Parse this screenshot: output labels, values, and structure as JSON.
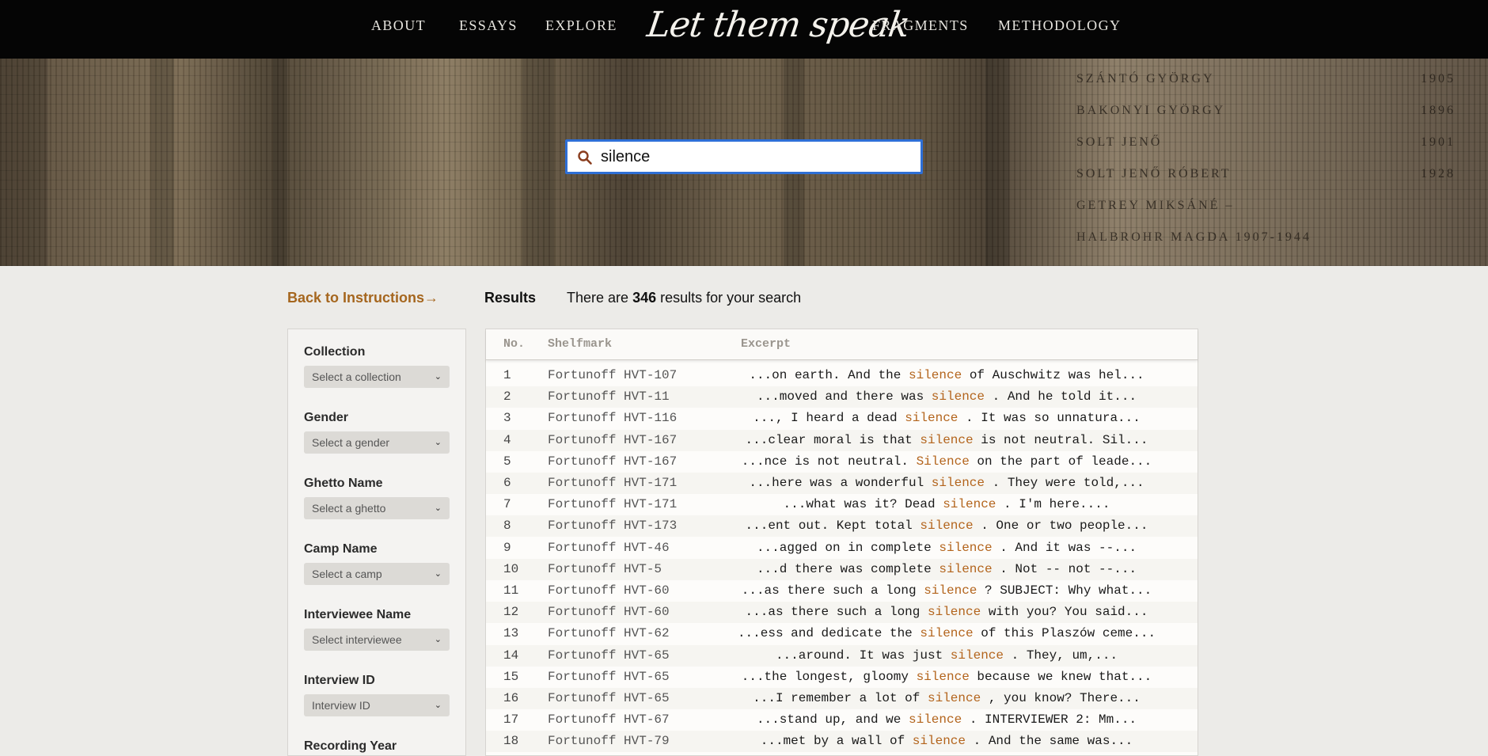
{
  "nav": {
    "left": [
      "ABOUT",
      "ESSAYS",
      "EXPLORE"
    ],
    "logo": "Let them speak",
    "right": [
      "FRAGMENTS",
      "METHODOLOGY"
    ]
  },
  "hero": {
    "memorial_names": [
      {
        "name": "SZÁNTÓ GYÖRGY",
        "year": "1905"
      },
      {
        "name": "BAKONYI GYÖRGY",
        "year": "1896"
      },
      {
        "name": "SOLT JENŐ",
        "year": "1901"
      },
      {
        "name": "SOLT JENŐ RÓBERT",
        "year": "1928"
      },
      {
        "name": "GETREY MIKSÁNÉ –",
        "year": ""
      },
      {
        "name": "HALBROHR MAGDA 1907-1944",
        "year": ""
      }
    ]
  },
  "search": {
    "value": "silence",
    "icon": "search-icon"
  },
  "back_link": "Back to Instructions→",
  "results": {
    "title": "Results",
    "count_prefix": "There are",
    "count": "346",
    "count_suffix": "results for your search",
    "columns": [
      "No.",
      "Shelfmark",
      "Excerpt"
    ],
    "rows": [
      {
        "no": "1",
        "shelfmark": "Fortunoff HVT-107",
        "before": "...on earth. And the",
        "hit": "silence",
        "after": "of Auschwitz was hel..."
      },
      {
        "no": "2",
        "shelfmark": "Fortunoff HVT-11",
        "before": "...moved and there was",
        "hit": "silence",
        "after": ". And he told it..."
      },
      {
        "no": "3",
        "shelfmark": "Fortunoff HVT-116",
        "before": "..., I heard a dead",
        "hit": "silence",
        "after": ". It was so unnatura..."
      },
      {
        "no": "4",
        "shelfmark": "Fortunoff HVT-167",
        "before": "...clear moral is that",
        "hit": "silence",
        "after": "is not neutral. Sil..."
      },
      {
        "no": "5",
        "shelfmark": "Fortunoff HVT-167",
        "before": "...nce is not neutral.",
        "hit": "Silence",
        "after": "on the part of leade..."
      },
      {
        "no": "6",
        "shelfmark": "Fortunoff HVT-171",
        "before": "...here was a wonderful",
        "hit": "silence",
        "after": ". They were told,..."
      },
      {
        "no": "7",
        "shelfmark": "Fortunoff HVT-171",
        "before": "...what was it? Dead",
        "hit": "silence",
        "after": ". I'm here...."
      },
      {
        "no": "8",
        "shelfmark": "Fortunoff HVT-173",
        "before": "...ent out. Kept total",
        "hit": "silence",
        "after": ". One or two people..."
      },
      {
        "no": "9",
        "shelfmark": "Fortunoff HVT-46",
        "before": "...agged on in complete",
        "hit": "silence",
        "after": ". And it was --..."
      },
      {
        "no": "10",
        "shelfmark": "Fortunoff HVT-5",
        "before": "...d there was complete",
        "hit": "silence",
        "after": ". Not -- not --..."
      },
      {
        "no": "11",
        "shelfmark": "Fortunoff HVT-60",
        "before": "...as there such a long",
        "hit": "silence",
        "after": "? SUBJECT: Why what..."
      },
      {
        "no": "12",
        "shelfmark": "Fortunoff HVT-60",
        "before": "...as there such a long",
        "hit": "silence",
        "after": "with you? You said..."
      },
      {
        "no": "13",
        "shelfmark": "Fortunoff HVT-62",
        "before": "...ess and dedicate the",
        "hit": "silence",
        "after": "of this Plaszów ceme..."
      },
      {
        "no": "14",
        "shelfmark": "Fortunoff HVT-65",
        "before": "...around. It was just",
        "hit": "silence",
        "after": ". They, um,..."
      },
      {
        "no": "15",
        "shelfmark": "Fortunoff HVT-65",
        "before": "...the longest, gloomy",
        "hit": "silence",
        "after": "because we knew that..."
      },
      {
        "no": "16",
        "shelfmark": "Fortunoff HVT-65",
        "before": "...I remember a lot of",
        "hit": "silence",
        "after": ", you know? There..."
      },
      {
        "no": "17",
        "shelfmark": "Fortunoff HVT-67",
        "before": "...stand up, and we",
        "hit": "silence",
        "after": ". INTERVIEWER 2: Mm..."
      },
      {
        "no": "18",
        "shelfmark": "Fortunoff HVT-79",
        "before": "...met by a wall of",
        "hit": "silence",
        "after": ". And the same was..."
      }
    ]
  },
  "filters": [
    {
      "label": "Collection",
      "placeholder": "Select a collection"
    },
    {
      "label": "Gender",
      "placeholder": "Select a gender"
    },
    {
      "label": "Ghetto Name",
      "placeholder": "Select a ghetto"
    },
    {
      "label": "Camp Name",
      "placeholder": "Select a camp"
    },
    {
      "label": "Interviewee Name",
      "placeholder": "Select interviewee"
    },
    {
      "label": "Interview ID",
      "placeholder": "Interview ID"
    },
    {
      "label": "Recording Year",
      "placeholder": ""
    }
  ],
  "colors": {
    "accent_link": "#a5661e",
    "highlight": "#b3641c",
    "search_border": "#2e6fd6",
    "nav_bg": "#050505"
  }
}
